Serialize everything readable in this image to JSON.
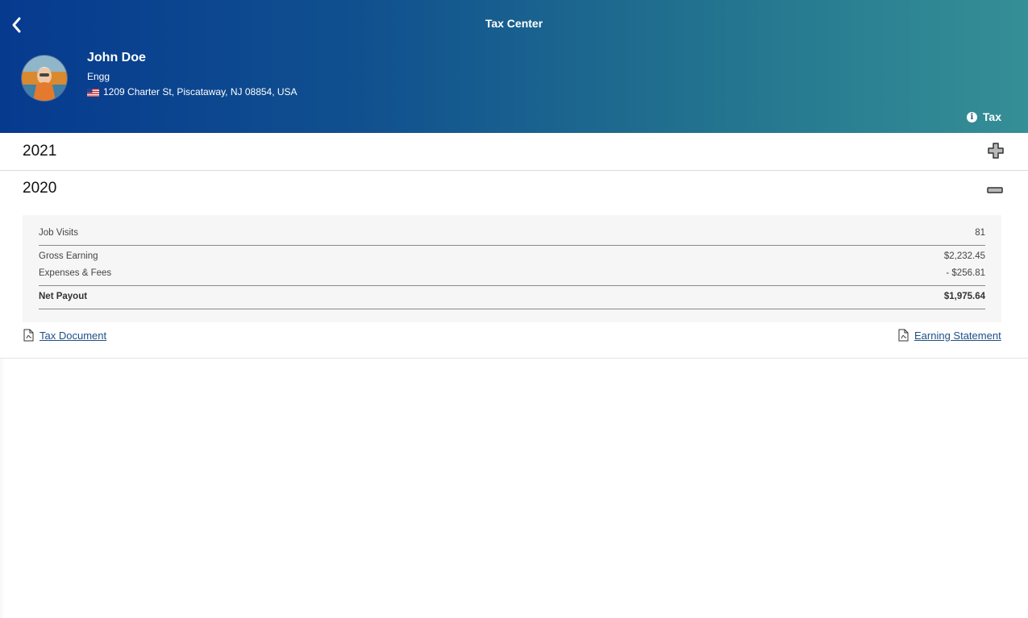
{
  "header": {
    "title": "Tax Center",
    "user": {
      "name": "John Doe",
      "role": "Engg",
      "address": "1209 Charter St, Piscataway, NJ 08854, USA",
      "flag_icon": "us-flag-icon"
    },
    "tax_link_label": "Tax",
    "colors": {
      "gradient_start": "#063a8f",
      "gradient_end": "#358f96"
    }
  },
  "years": [
    {
      "year": "2021",
      "expanded": false
    },
    {
      "year": "2020",
      "expanded": true,
      "summary": {
        "job_visits": {
          "label": "Job Visits",
          "value": "81"
        },
        "gross_earning": {
          "label": "Gross Earning",
          "value": "$2,232.45"
        },
        "expenses_fees": {
          "label": "Expenses & Fees",
          "value": "- $256.81"
        },
        "net_payout": {
          "label": "Net Payout",
          "value": "$1,975.64"
        }
      },
      "links": {
        "tax_document": "Tax Document",
        "earning_statement": "Earning Statement"
      }
    }
  ]
}
